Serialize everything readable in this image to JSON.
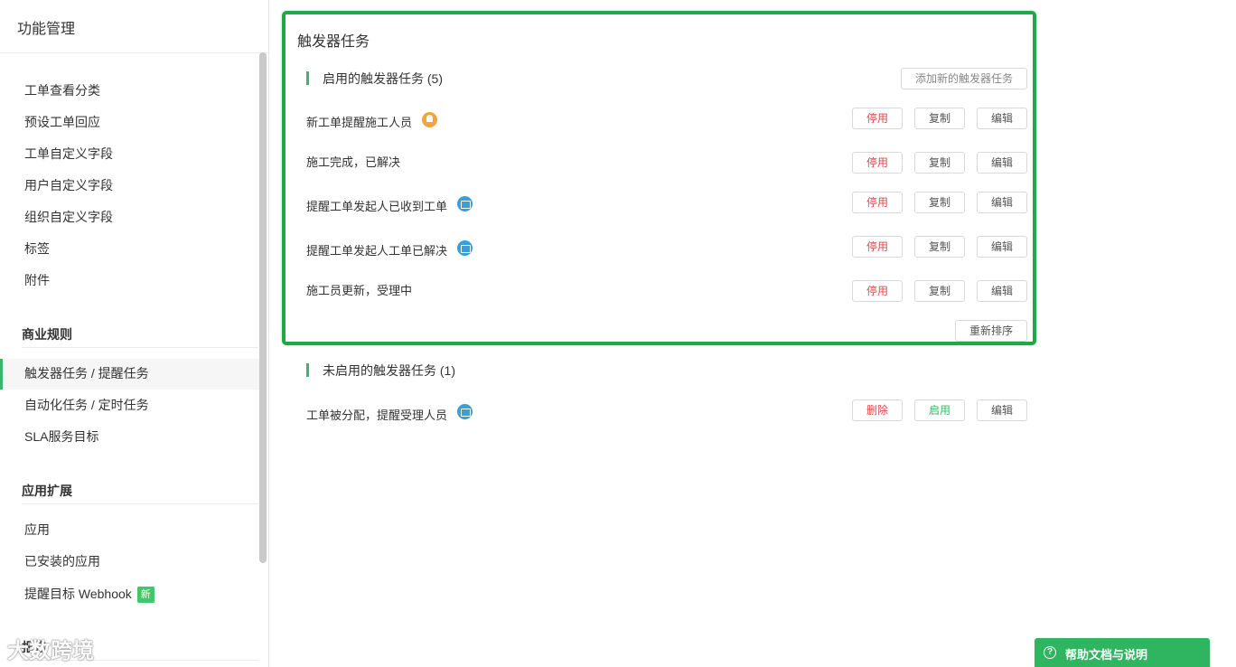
{
  "sidebar": {
    "title": "功能管理",
    "items_top": [
      "工单查看分类",
      "预设工单回应",
      "工单自定义字段",
      "用户自定义字段",
      "组织自定义字段",
      "标签",
      "附件"
    ],
    "section_business": "商业规则",
    "items_business": [
      "触发器任务 / 提醒任务",
      "自动化任务 / 定时任务",
      "SLA服务目标"
    ],
    "section_apps": "应用扩展",
    "items_apps": [
      "应用",
      "已安装的应用",
      "提醒目标 Webhook"
    ],
    "badge_new": "新",
    "section_reports": "报告"
  },
  "panel": {
    "title": "触发器任务",
    "enabled_header": "启用的触发器任务 (5)",
    "add_button": "添加新的触发器任务",
    "enabled_tasks": [
      {
        "name": "新工单提醒施工人员",
        "icon": "bell-icon"
      },
      {
        "name": "施工完成，已解决",
        "icon": ""
      },
      {
        "name": "提醒工单发起人已收到工单",
        "icon": "mail-icon"
      },
      {
        "name": "提醒工单发起人工单已解决",
        "icon": "mail-icon"
      },
      {
        "name": "施工员更新，受理中",
        "icon": ""
      }
    ],
    "reorder_button": "重新排序",
    "disabled_header": "未启用的触发器任务 (1)",
    "disabled_tasks": [
      {
        "name": "工单被分配，提醒受理人员",
        "icon": "mail-icon"
      }
    ],
    "btn_stop": "停用",
    "btn_copy": "复制",
    "btn_edit": "编辑",
    "btn_delete": "删除",
    "btn_enable": "启用"
  },
  "help": {
    "label": "帮助文档与说明",
    "icon": "?"
  },
  "watermark": "大数跨境",
  "colors": {
    "accent": "#3bb56a",
    "highlight_border": "#1fa846",
    "danger": "#e5454f"
  }
}
